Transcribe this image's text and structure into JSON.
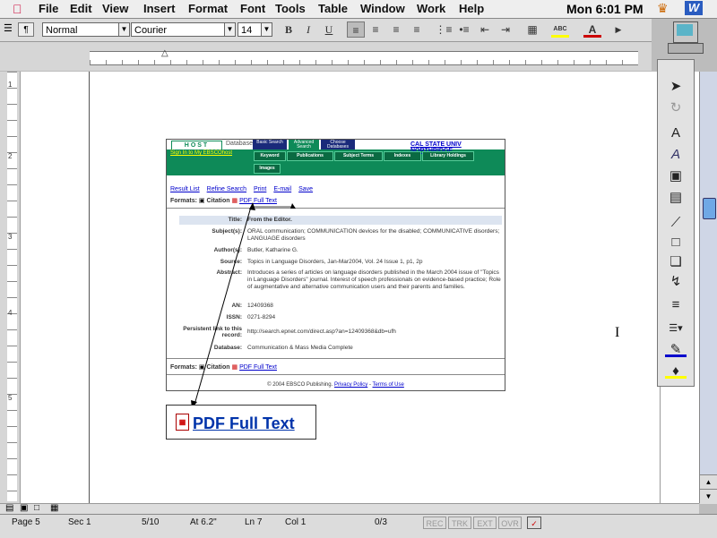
{
  "menubar": {
    "items": [
      "File",
      "Edit",
      "View",
      "Insert",
      "Format",
      "Font",
      "Tools",
      "Table",
      "Window",
      "Work",
      "Help"
    ],
    "clock": "Mon 6:01 PM"
  },
  "toolbar": {
    "style": "Normal",
    "font": "Courier",
    "size": "14",
    "bold": "B",
    "italic": "I",
    "underline": "U",
    "highlight": "ABC",
    "font_color": "A"
  },
  "ebsco": {
    "logo": "HOST",
    "databases": "Databases",
    "tabs": [
      "Basic Search",
      "Advanced Search",
      "Choose Databases"
    ],
    "school": "CAL STATE UNIV NORTHRIDGE",
    "signin": "Sign In to My EBSCOhost",
    "nav": [
      "Keyword",
      "Publications",
      "Subject Terms",
      "Indexes",
      "Library Holdings",
      "Images"
    ],
    "links": [
      "Result List",
      "Refine Search",
      "Print",
      "E-mail",
      "Save"
    ],
    "formats_label": "Formats:",
    "citation": "Citation",
    "pdf_label": "PDF Full Text",
    "records": [
      {
        "k": "Title:",
        "v": "From the Editor."
      },
      {
        "k": "Subject(s):",
        "v": "ORAL communication; COMMUNICATION devices for the disabled; COMMUNICATIVE disorders; LANGUAGE disorders"
      },
      {
        "k": "Author(s):",
        "v": "Butler, Katharine G."
      },
      {
        "k": "Source:",
        "v": "Topics in Language Disorders, Jan-Mar2004, Vol. 24 Issue 1, p1, 2p"
      },
      {
        "k": "Abstract:",
        "v": "Introduces a series of articles on language disorders published in the March 2004 issue of \"Topics in Language Disorders\" journal. Interest of speech professionals on evidence-based practice; Role of augmentative and alternative communication users and their parents and families."
      },
      {
        "k": "AN:",
        "v": "12409368"
      },
      {
        "k": "ISSN:",
        "v": "0271-8294"
      },
      {
        "k": "Persistent link to this record:",
        "v": "http://search.epnet.com/direct.asp?an=12409368&db=ufh"
      },
      {
        "k": "Database:",
        "v": "Communication & Mass Media Complete"
      }
    ],
    "footer_text": "© 2004 EBSCO Publishing.",
    "privacy": "Privacy Policy",
    "terms": "Terms of Use"
  },
  "zoom_box": {
    "label": "PDF Full Text"
  },
  "status": {
    "page": "Page 5",
    "sec": "Sec 1",
    "pages": "5/10",
    "at": "At 6.2\"",
    "ln": "Ln 7",
    "col": "Col 1",
    "count": "0/3",
    "rec": "REC",
    "trk": "TRK",
    "ext": "EXT",
    "ovr": "OVR"
  },
  "vruler_nums": [
    "1",
    "2",
    "3",
    "4",
    "5"
  ]
}
